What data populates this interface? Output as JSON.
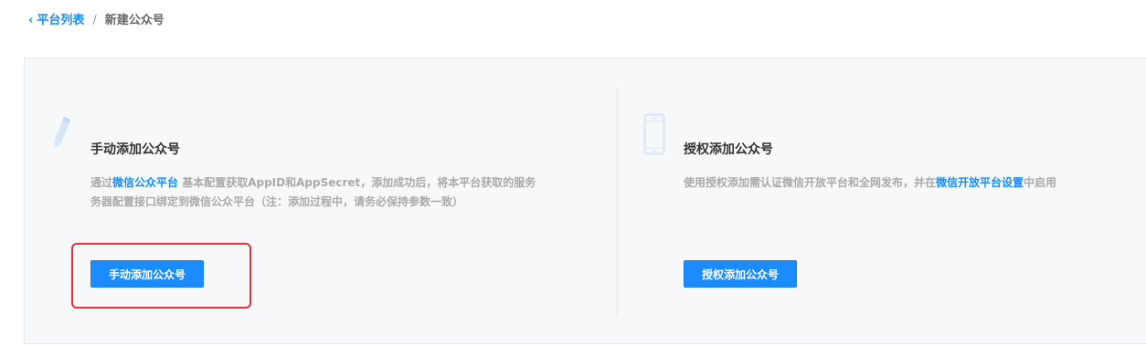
{
  "breadcrumb": {
    "back_label": "平台列表",
    "separator": "/",
    "current": "新建公众号"
  },
  "manual_card": {
    "icon": "pencil-icon",
    "title": "手动添加公众号",
    "desc_prefix": "通过",
    "desc_link": "微信公众平台",
    "desc_line1_rest": " 基本配置获取AppID和AppSecret，添加成功后，将本平台获取的服务",
    "desc_line2": "务器配置接口绑定到微信公众平台（注：添加过程中，请务必保持参数一致）",
    "button_label": "手动添加公众号"
  },
  "auth_card": {
    "icon": "phone-icon",
    "title": "授权添加公众号",
    "desc_prefix": "使用授权添加需认证微信开放平台和全网发布，并在",
    "desc_link": "微信开放平台设置",
    "desc_suffix": "中启用",
    "button_label": "授权添加公众号"
  },
  "colors": {
    "accent": "#1a8cff",
    "highlight": "#e8303a",
    "panel_bg": "#f7f8fa"
  }
}
